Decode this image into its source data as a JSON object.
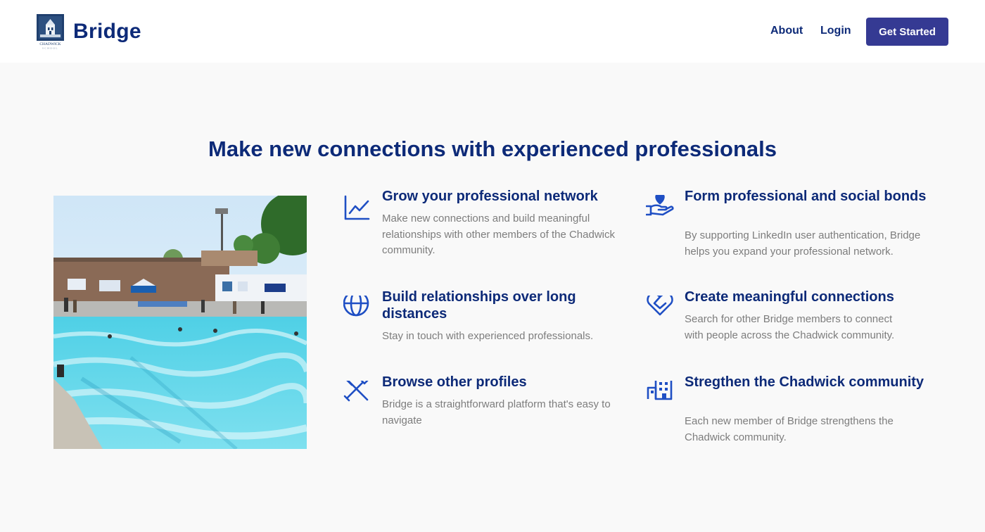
{
  "header": {
    "logo_text": "CHADWICK SCHOOL",
    "brand": "Bridge",
    "nav": {
      "about": "About",
      "login": "Login"
    },
    "cta": "Get Started"
  },
  "hero": {
    "title": "Make new connections with experienced professionals"
  },
  "features": [
    {
      "icon": "chart-line-icon",
      "title": "Grow your professional network",
      "desc": "Make new connections and build meaningful relationships with other members of the Chadwick community."
    },
    {
      "icon": "globe-icon",
      "title": "Build relationships over long distances",
      "desc": "Stay in touch with experienced professionals."
    },
    {
      "icon": "tools-icon",
      "title": "Browse other profiles",
      "desc": "Bridge is a straightforward platform that's easy to navigate"
    },
    {
      "icon": "hand-heart-icon",
      "title": "Form professional and social bonds",
      "desc": "By supporting LinkedIn user authentication, Bridge helps you expand your professional network."
    },
    {
      "icon": "heart-icon",
      "title": "Create meaningful connections",
      "desc": "Search for other Bridge members to connect with people across the Chadwick community."
    },
    {
      "icon": "building-icon",
      "title": "Stregthen the Chadwick community",
      "desc": "Each new member of Bridge strengthens the Chadwick community."
    }
  ],
  "colors": {
    "brand_navy": "#0d2a78",
    "button": "#353a93",
    "icon_blue": "#1f4fc4",
    "text_gray": "#7d7d7d",
    "background": "#f9f9f9"
  }
}
